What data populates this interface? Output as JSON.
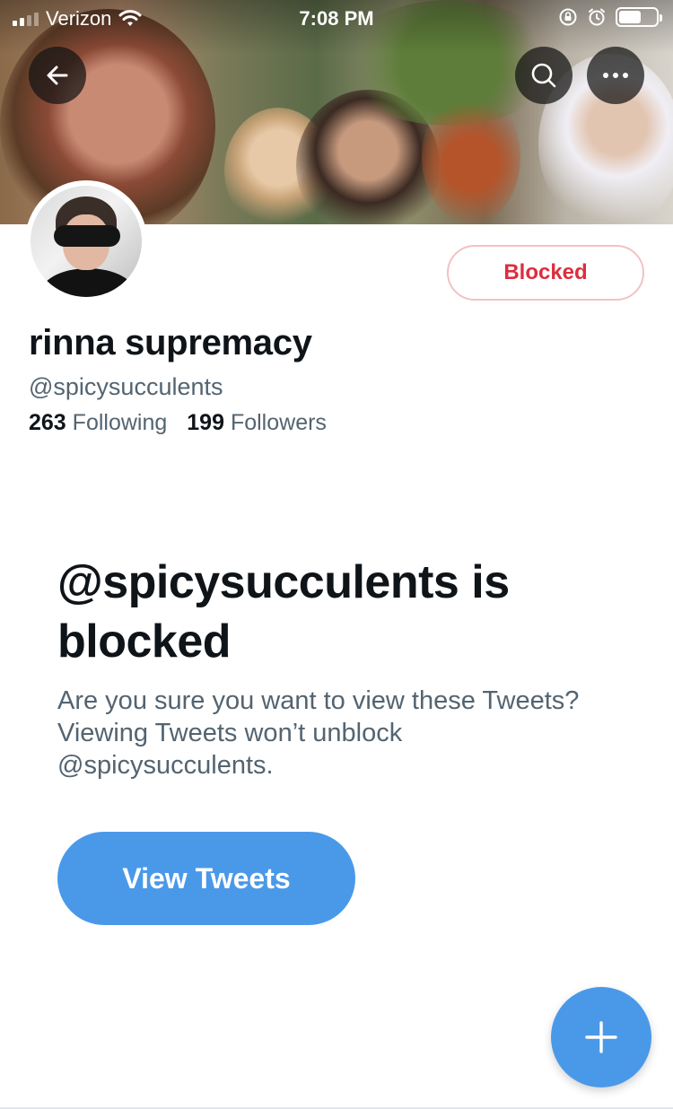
{
  "status_bar": {
    "carrier": "Verizon",
    "time": "7:08 PM"
  },
  "profile": {
    "display_name": "rinna supremacy",
    "handle": "@spicysucculents",
    "following_count": "263",
    "following_label": "Following",
    "followers_count": "199",
    "followers_label": "Followers",
    "blocked_button_label": "Blocked"
  },
  "blocked_notice": {
    "title": "@spicysucculents is blocked",
    "body": "Are you sure you want to view these Tweets? Viewing Tweets won’t unblock @spicysucculents.",
    "view_button_label": "View Tweets"
  },
  "icons": {
    "back": "arrow-left-icon",
    "search": "search-icon",
    "more": "more-icon",
    "compose": "plus-icon"
  },
  "colors": {
    "accent": "#4a99e9",
    "blocked_red": "#dc2e3e"
  }
}
